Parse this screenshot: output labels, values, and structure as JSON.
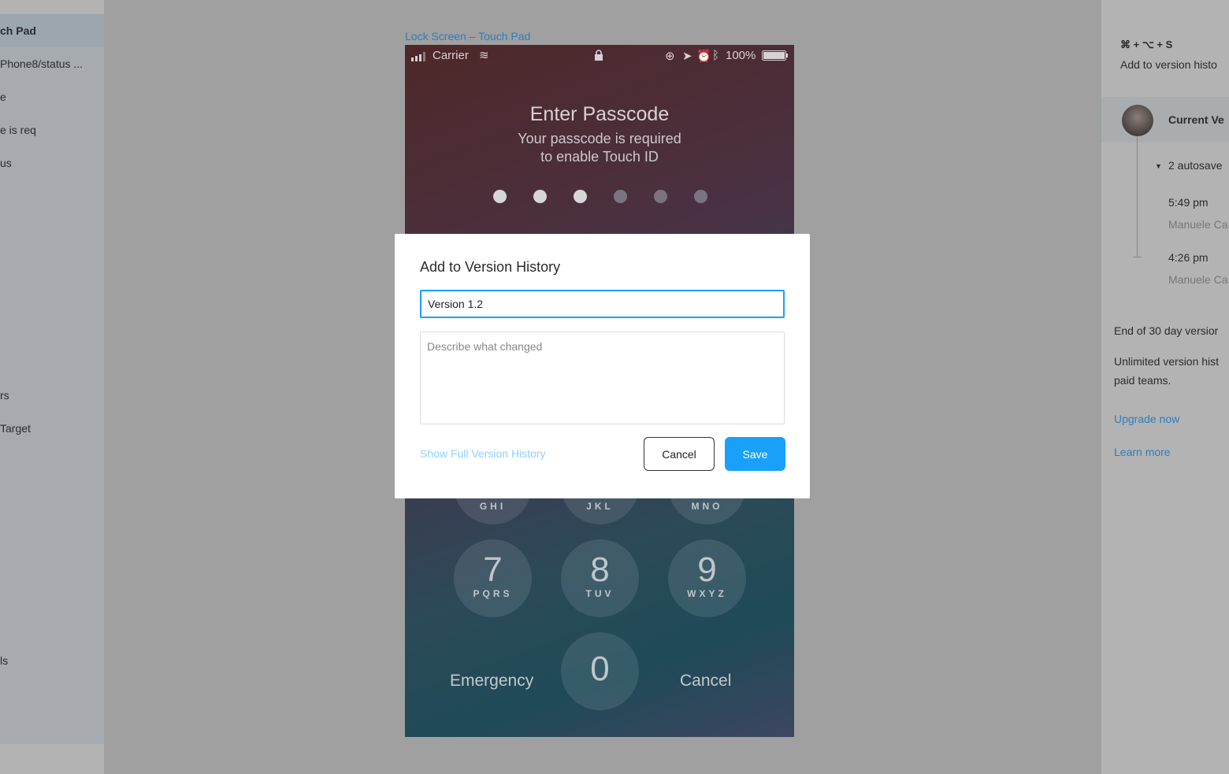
{
  "layers_panel": {
    "items": [
      {
        "label": "ch Pad",
        "selected": true
      },
      {
        "label": "Phone8/status ..."
      },
      {
        "label": "e"
      },
      {
        "label": "e is req"
      },
      {
        "label": "us"
      },
      {
        "label": "rs"
      },
      {
        "label": "Target"
      },
      {
        "label": "ls"
      }
    ]
  },
  "frame_label": "Lock Screen – Touch Pad",
  "phone": {
    "status": {
      "carrier": "Carrier",
      "battery": "100%"
    },
    "title": "Enter Passcode",
    "subtitle_1": "Your passcode is required",
    "subtitle_2": "to enable Touch ID",
    "dots_filled": 3,
    "dots_total": 6,
    "keys": [
      {
        "num": "",
        "letters": "GHI"
      },
      {
        "num": "",
        "letters": "JKL"
      },
      {
        "num": "",
        "letters": "MNO"
      },
      {
        "num": "7",
        "letters": "PQRS"
      },
      {
        "num": "8",
        "letters": "TUV"
      },
      {
        "num": "9",
        "letters": "WXYZ"
      },
      {
        "num": "0",
        "letters": ""
      }
    ],
    "emergency": "Emergency",
    "cancel": "Cancel"
  },
  "dialog": {
    "title": "Add to Version History",
    "name_value": "Version 1.2",
    "description_placeholder": "Describe what changed",
    "show_history_link": "Show Full Version History",
    "cancel_label": "Cancel",
    "save_label": "Save"
  },
  "version_panel": {
    "shortcut": "⌘ + ⌥ + S",
    "shortcut_desc": "Add to version histo",
    "current": "Current Ve",
    "autosave": "2 autosave",
    "entries": [
      {
        "time": "5:49 pm",
        "author": "Manuele Ca"
      },
      {
        "time": "4:26 pm",
        "author": "Manuele Ca"
      }
    ],
    "end_text": "End of 30 day versior",
    "unlimited_1": "Unlimited version hist",
    "unlimited_2": "paid teams.",
    "upgrade": "Upgrade now",
    "learn": "Learn more"
  },
  "colors": {
    "accent": "#18a0fb",
    "link_light": "#8fd0fc"
  }
}
